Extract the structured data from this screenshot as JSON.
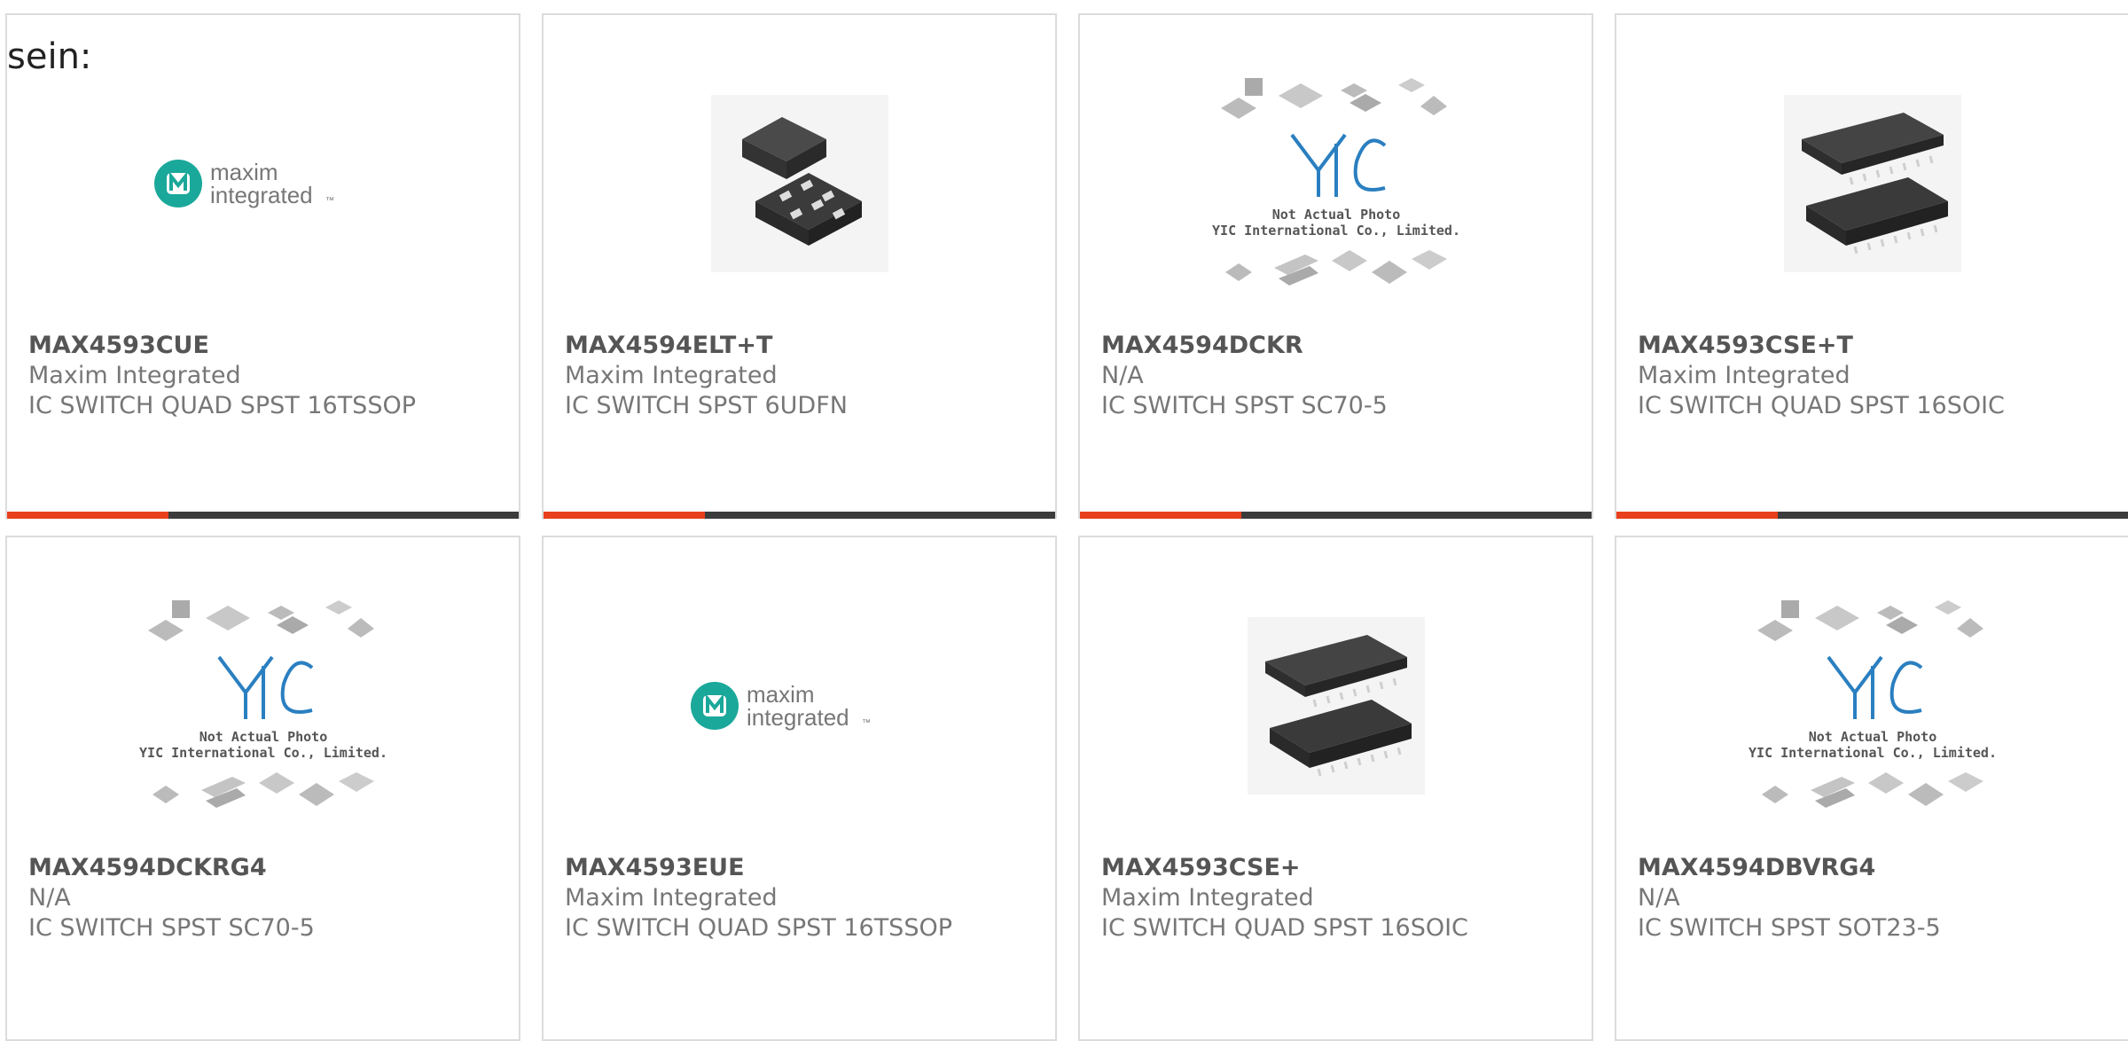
{
  "heading": "sein:",
  "colors": {
    "accent": "#e8401c",
    "bar_dark": "#3c3c3c",
    "maxim_teal": "#1aa89a",
    "yic_blue": "#2a7fc0"
  },
  "yic_caption": [
    "Not Actual Photo",
    "YIC International Co., Limited."
  ],
  "maxim_logo": [
    "maxim",
    "integrated",
    "™"
  ],
  "products": [
    {
      "part": "MAX4593CUE",
      "manufacturer": "Maxim Integrated",
      "description": "IC SWITCH QUAD SPST 16TSSOP",
      "image": "maxim-logo"
    },
    {
      "part": "MAX4594ELT+T",
      "manufacturer": "Maxim Integrated",
      "description": "IC SWITCH SPST 6UDFN",
      "image": "udfn-chip"
    },
    {
      "part": "MAX4594DCKR",
      "manufacturer": "N/A",
      "description": "IC SWITCH SPST SC70-5",
      "image": "yic-placeholder"
    },
    {
      "part": "MAX4593CSE+T",
      "manufacturer": "Maxim Integrated",
      "description": "IC SWITCH QUAD SPST 16SOIC",
      "image": "soic-chip"
    },
    {
      "part": "MAX4594DCKRG4",
      "manufacturer": "N/A",
      "description": "IC SWITCH SPST SC70-5",
      "image": "yic-placeholder"
    },
    {
      "part": "MAX4593EUE",
      "manufacturer": "Maxim Integrated",
      "description": "IC SWITCH QUAD SPST 16TSSOP",
      "image": "maxim-logo"
    },
    {
      "part": "MAX4593CSE+",
      "manufacturer": "Maxim Integrated",
      "description": "IC SWITCH QUAD SPST 16SOIC",
      "image": "soic-chip"
    },
    {
      "part": "MAX4594DBVRG4",
      "manufacturer": "N/A",
      "description": "IC SWITCH SPST SOT23-5",
      "image": "yic-placeholder"
    }
  ]
}
